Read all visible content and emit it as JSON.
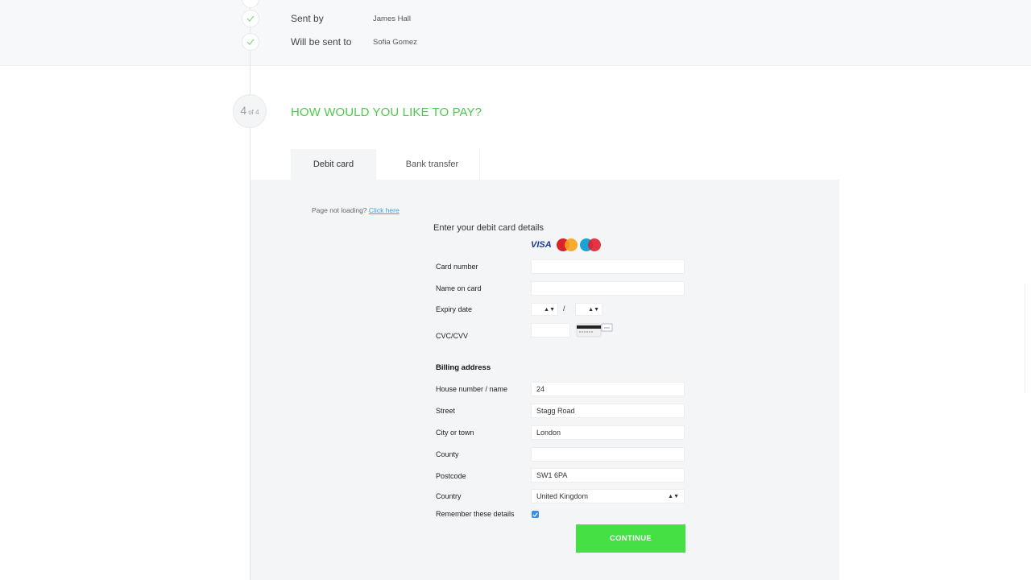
{
  "summary": {
    "rows": [
      {
        "label": "Sent by",
        "value": "James Hall"
      },
      {
        "label": "Will be sent to",
        "value": "Sofia Gomez"
      }
    ]
  },
  "step": {
    "number": "4",
    "of": "of 4",
    "title": "HOW WOULD YOU LIKE TO PAY?"
  },
  "tabs": [
    {
      "label": "Debit card",
      "active": true
    },
    {
      "label": "Bank transfer",
      "active": false
    }
  ],
  "notice": {
    "text": "Page not loading?",
    "link": "Click here"
  },
  "form": {
    "title": "Enter your debit card details",
    "card_brands": [
      "VISA",
      "MasterCard",
      "Maestro"
    ],
    "card_number_label": "Card number",
    "card_number_value": "",
    "name_on_card_label": "Name on card",
    "name_on_card_value": "",
    "expiry_label": "Expiry date",
    "expiry_separator": "/",
    "cvc_label": "CVC/CVV",
    "billing_heading": "Billing address",
    "house_label": "House number / name",
    "house_value": "24",
    "street_label": "Street",
    "street_value": "Stagg Road",
    "city_label": "City or town",
    "city_value": "London",
    "county_label": "County",
    "county_value": "",
    "postcode_label": "Postcode",
    "postcode_value": "SW1 6PA",
    "country_label": "Country",
    "country_value": "United Kingdom",
    "remember_label": "Remember these details",
    "remember_checked": true,
    "continue_label": "CONTINUE"
  },
  "colors": {
    "accent_green": "#4ec94e",
    "button_green": "#44e044",
    "link_blue": "#3aa3e3"
  }
}
